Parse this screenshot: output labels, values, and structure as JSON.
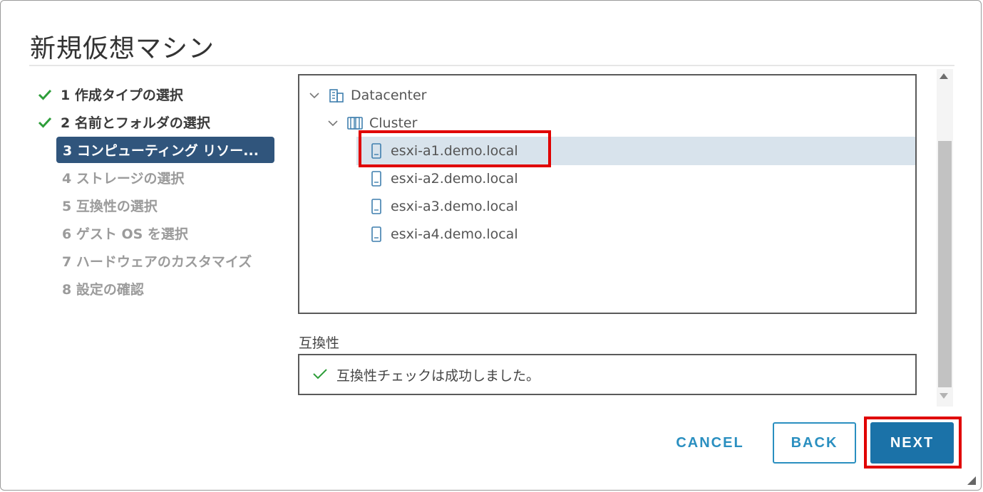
{
  "dialog": {
    "title": "新規仮想マシン"
  },
  "steps": [
    {
      "label": "1 作成タイプの選択",
      "state": "done"
    },
    {
      "label": "2 名前とフォルダの選択",
      "state": "done"
    },
    {
      "label": "3 コンピューティング リソー...",
      "state": "active"
    },
    {
      "label": "4 ストレージの選択",
      "state": "future"
    },
    {
      "label": "5 互換性の選択",
      "state": "future"
    },
    {
      "label": "6 ゲスト OS を選択",
      "state": "future"
    },
    {
      "label": "7 ハードウェアのカスタマイズ",
      "state": "future"
    },
    {
      "label": "8 設定の確認",
      "state": "future"
    }
  ],
  "tree": {
    "datacenter": {
      "label": "Datacenter",
      "icon": "datacenter-icon"
    },
    "cluster": {
      "label": "Cluster",
      "icon": "cluster-icon"
    },
    "hosts": [
      {
        "label": "esxi-a1.demo.local",
        "icon": "host-icon",
        "selected": true
      },
      {
        "label": "esxi-a2.demo.local",
        "icon": "host-icon",
        "selected": false
      },
      {
        "label": "esxi-a3.demo.local",
        "icon": "host-icon",
        "selected": false
      },
      {
        "label": "esxi-a4.demo.local",
        "icon": "host-icon",
        "selected": false
      }
    ]
  },
  "compatibility": {
    "label": "互換性",
    "message": "互換性チェックは成功しました。",
    "icon": "check-icon"
  },
  "buttons": {
    "cancel": "CANCEL",
    "back": "BACK",
    "next": "NEXT"
  },
  "colors": {
    "active_step_bg": "#30557c",
    "check_green": "#2e9e3a",
    "accent_blue": "#1b72a8",
    "highlight_red": "#e00000",
    "selected_row_bg": "#d8e3ec"
  }
}
